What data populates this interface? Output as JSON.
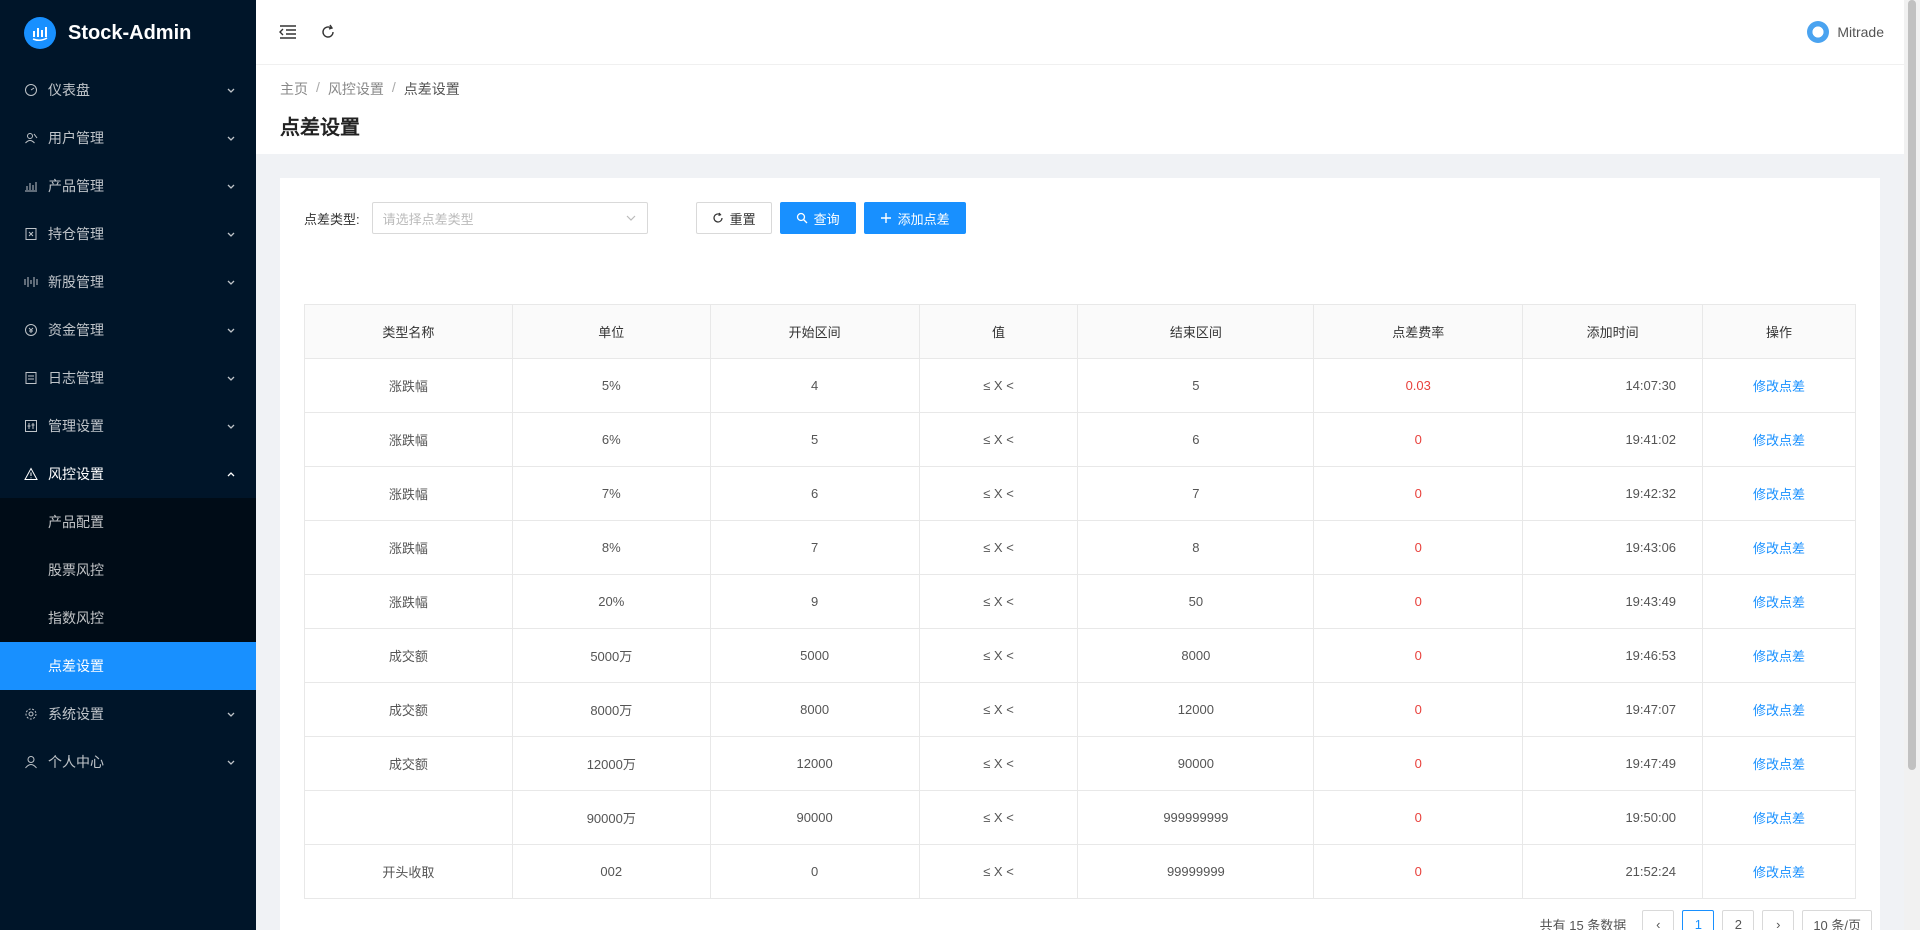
{
  "app": {
    "title": "Stock-Admin"
  },
  "header": {
    "user_name": "Mitrade"
  },
  "sidebar": {
    "items": [
      {
        "label": "仪表盘",
        "icon": "dashboard-icon"
      },
      {
        "label": "用户管理",
        "icon": "users-icon"
      },
      {
        "label": "产品管理",
        "icon": "chart-icon"
      },
      {
        "label": "持仓管理",
        "icon": "wallet-icon"
      },
      {
        "label": "新股管理",
        "icon": "signal-icon"
      },
      {
        "label": "资金管理",
        "icon": "money-icon"
      },
      {
        "label": "日志管理",
        "icon": "log-icon"
      },
      {
        "label": "管理设置",
        "icon": "settings-panel-icon"
      },
      {
        "label": "风控设置",
        "icon": "warning-icon"
      },
      {
        "label": "系统设置",
        "icon": "gear-icon"
      },
      {
        "label": "个人中心",
        "icon": "user-icon"
      }
    ],
    "risk_sub": [
      "产品配置",
      "股票风控",
      "指数风控",
      "点差设置"
    ]
  },
  "breadcrumb": {
    "home": "主页",
    "parent": "风控设置",
    "current": "点差设置"
  },
  "page": {
    "title": "点差设置"
  },
  "filter": {
    "label": "点差类型:",
    "placeholder": "请选择点差类型",
    "reset": "重置",
    "query": "查询",
    "add": "添加点差"
  },
  "table": {
    "headers": [
      "类型名称",
      "单位",
      "开始区间",
      "值",
      "结束区间",
      "点差费率",
      "添加时间",
      "操作"
    ],
    "rows": [
      [
        "涨跌幅",
        "5%",
        "4",
        "≤ X <",
        "5",
        "0.03",
        "14:07:30",
        "修改点差"
      ],
      [
        "涨跌幅",
        "6%",
        "5",
        "≤ X <",
        "6",
        "0",
        "19:41:02",
        "修改点差"
      ],
      [
        "涨跌幅",
        "7%",
        "6",
        "≤ X <",
        "7",
        "0",
        "19:42:32",
        "修改点差"
      ],
      [
        "涨跌幅",
        "8%",
        "7",
        "≤ X <",
        "8",
        "0",
        "19:43:06",
        "修改点差"
      ],
      [
        "涨跌幅",
        "20%",
        "9",
        "≤ X <",
        "50",
        "0",
        "19:43:49",
        "修改点差"
      ],
      [
        "成交额",
        "5000万",
        "5000",
        "≤ X <",
        "8000",
        "0",
        "19:46:53",
        "修改点差"
      ],
      [
        "成交额",
        "8000万",
        "8000",
        "≤ X <",
        "12000",
        "0",
        "19:47:07",
        "修改点差"
      ],
      [
        "成交额",
        "12000万",
        "12000",
        "≤ X <",
        "90000",
        "0",
        "19:47:49",
        "修改点差"
      ],
      [
        "",
        "90000万",
        "90000",
        "≤ X <",
        "999999999",
        "0",
        "19:50:00",
        "修改点差"
      ],
      [
        "开头收取",
        "002",
        "0",
        "≤ X <",
        "99999999",
        "0",
        "21:52:24",
        "修改点差"
      ]
    ]
  },
  "pagination": {
    "total": "共有 15 条数据",
    "pages": [
      "1",
      "2"
    ],
    "page_size": "10 条/页"
  },
  "colors": {
    "primary": "#1890ff",
    "sidebar_bg": "#001529",
    "danger": "#e8413c"
  }
}
